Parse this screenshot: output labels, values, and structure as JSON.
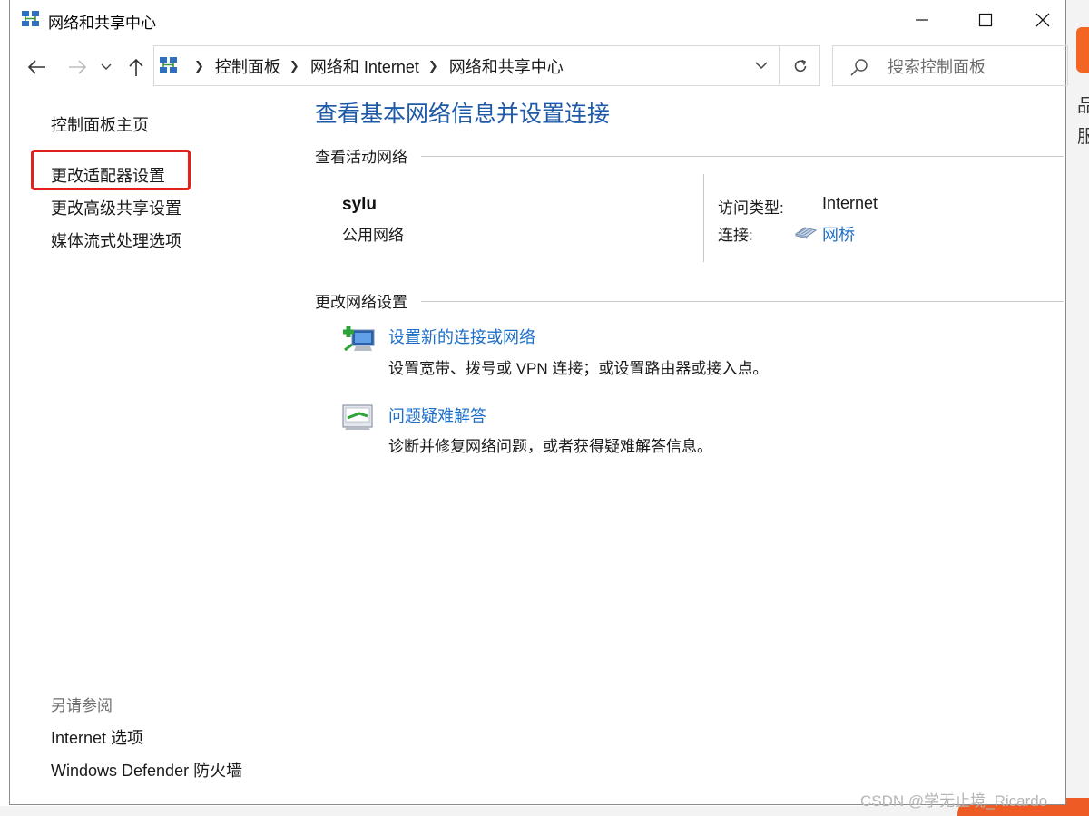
{
  "window": {
    "title": "网络和共享中心",
    "controls": {
      "minimize": "minimize",
      "maximize": "maximize",
      "close": "close"
    }
  },
  "nav": {
    "breadcrumbs": [
      "控制面板",
      "网络和 Internet",
      "网络和共享中心"
    ],
    "search_placeholder": "搜索控制面板"
  },
  "left_pane": {
    "home": "控制面板主页",
    "links": [
      "更改适配器设置",
      "更改高级共享设置",
      "媒体流式处理选项"
    ],
    "see_also_heading": "另请参阅",
    "see_also": [
      "Internet 选项",
      "Windows Defender 防火墙"
    ]
  },
  "main": {
    "title": "查看基本网络信息并设置连接",
    "active_networks_heading": "查看活动网络",
    "network": {
      "name": "sylu",
      "type": "公用网络",
      "access_type_label": "访问类型:",
      "access_type_value": "Internet",
      "connections_label": "连接:",
      "connection_name": "网桥"
    },
    "change_settings_heading": "更改网络设置",
    "tasks": [
      {
        "title": "设置新的连接或网络",
        "desc": "设置宽带、拨号或 VPN 连接；或设置路由器或接入点。"
      },
      {
        "title": "问题疑难解答",
        "desc": "诊断并修复网络问题，或者获得疑难解答信息。"
      }
    ]
  },
  "background": {
    "watermark": "CSDN @学无止境_Ricardo",
    "side_chars": [
      "品",
      "服"
    ]
  },
  "colors": {
    "heading_blue": "#1e5aa8",
    "link_blue": "#1e6fc7",
    "highlight_red": "#e3201b"
  }
}
